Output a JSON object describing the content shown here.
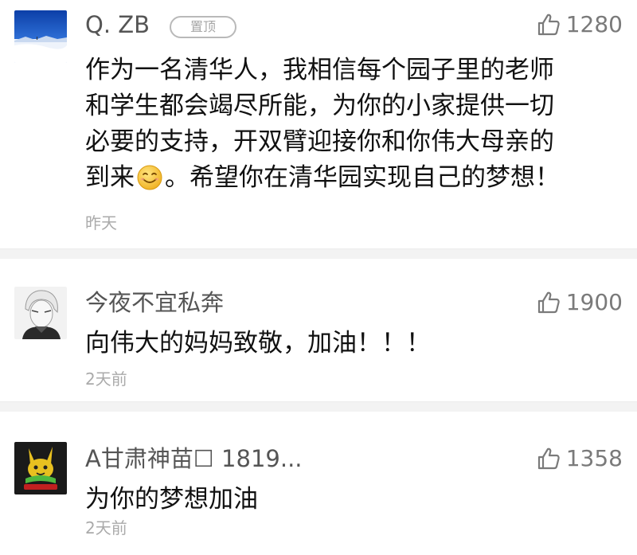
{
  "comments": [
    {
      "username": "Q. ZB",
      "badge": "置顶",
      "likes": "1280",
      "lines": [
        "作为一名清华人，我相信每个园子里的老师",
        "和学生都会竭尽所能，为你的小家提供一切",
        "必要的支持，开双臂迎接你和你伟大母亲的"
      ],
      "last_line_before_emoji": "到来",
      "emoji": "smile-emoji",
      "last_line_after_emoji": "。希望你在清华园实现自己的梦想！",
      "time": "昨天"
    },
    {
      "username": "今夜不宜私奔",
      "likes": "1900",
      "lines": [
        "向伟大的妈妈致敬，加油！！！"
      ],
      "time": "2天前"
    },
    {
      "username": "A甘肃神苗☐ 1819...",
      "likes": "1358",
      "lines": [
        "为你的梦想加油"
      ],
      "time": "2天前"
    }
  ],
  "icons": {
    "like": "thumbs-up-icon"
  },
  "colors": {
    "divider": "#f3f3f3",
    "meta_text": "#aaaaaa",
    "username": "#555555",
    "like": "#7a7a7a"
  }
}
